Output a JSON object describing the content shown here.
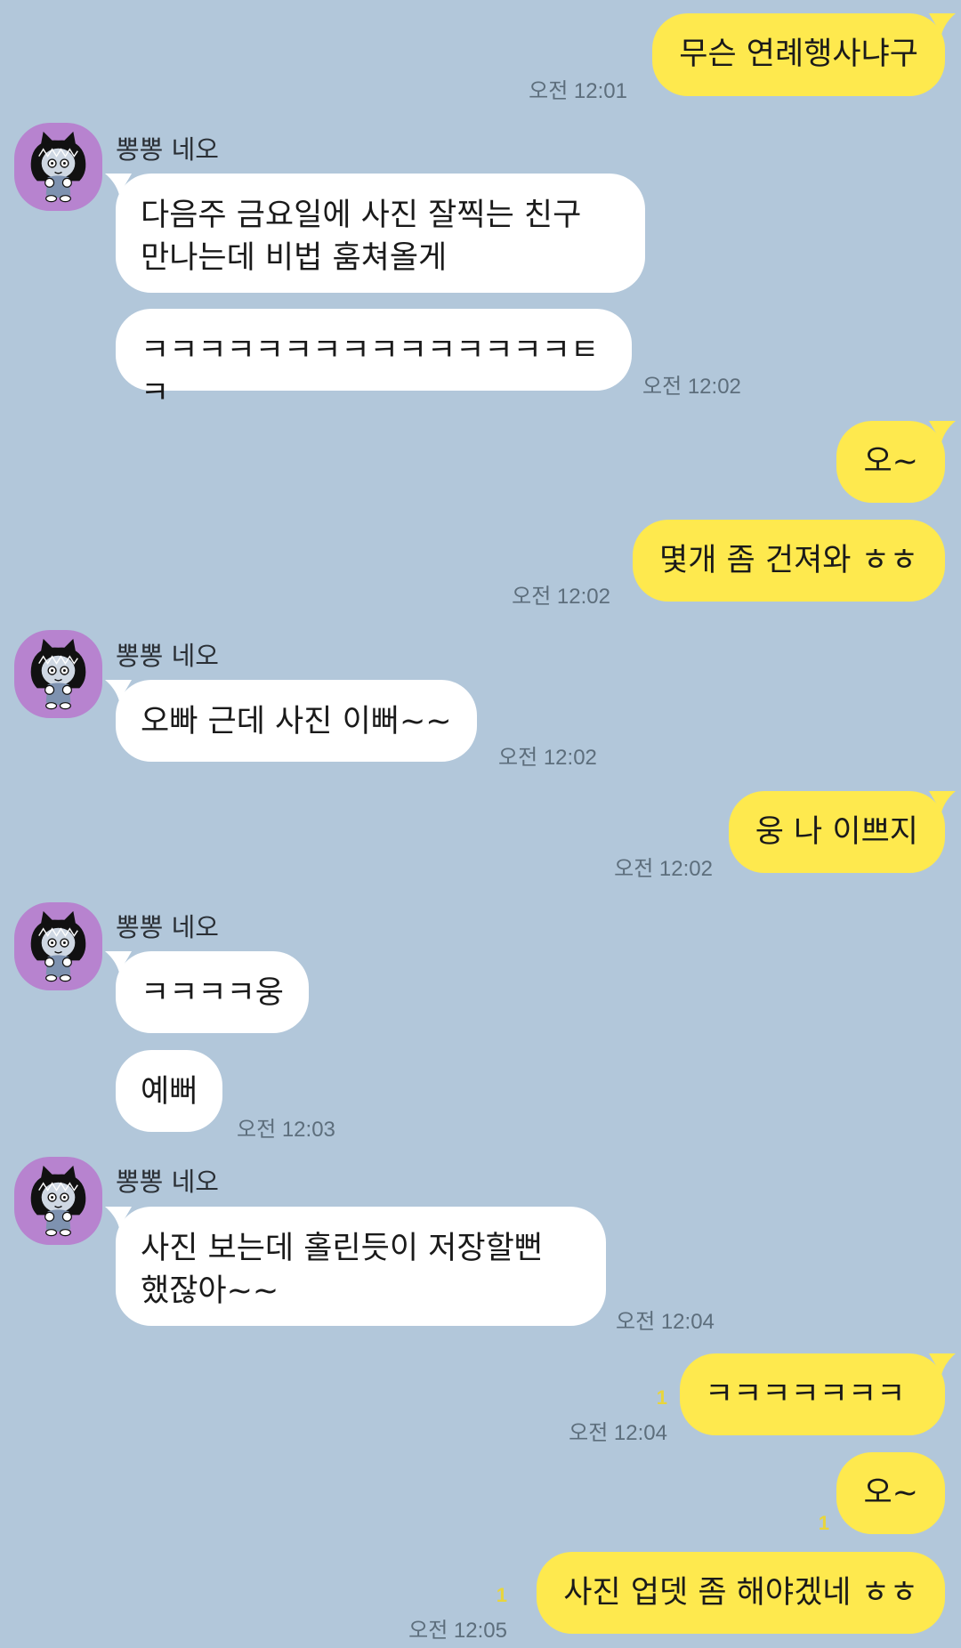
{
  "chat": {
    "sender_name": "뽕뽕 네오",
    "messages": [
      {
        "text": "무슨 연례행사냐구",
        "time": "오전 12:01"
      },
      {
        "text": "다음주 금요일에 사진 잘찍는 친구\n만나는데 비법 훔쳐올게"
      },
      {
        "text": "ㅋㅋㅋㅋㅋㅋㅋㅋㅋㅋㅋㅋㅋㅋㅋㅌㅋ",
        "time": "오전 12:02"
      },
      {
        "text": "오~"
      },
      {
        "text": "몇개 좀 건져와 ㅎㅎ",
        "time": "오전 12:02"
      },
      {
        "text": "오빠 근데 사진 이뻐~~",
        "time": "오전 12:02"
      },
      {
        "text": "웅 나 이쁘지",
        "time": "오전 12:02"
      },
      {
        "text": "ㅋㅋㅋㅋ웅"
      },
      {
        "text": "예뻐",
        "time": "오전 12:03"
      },
      {
        "text": "사진 보는데 홀린듯이 저장할뻔\n했잖아~~",
        "time": "오전 12:04"
      },
      {
        "text": "ㅋㅋㅋㅋㅋㅋㅋ",
        "time": "오전 12:04",
        "unread": "1"
      },
      {
        "text": "오~",
        "unread": "1"
      },
      {
        "text": "사진 업뎃 좀 해야겠네 ㅎㅎ",
        "time": "오전 12:05",
        "unread": "1"
      }
    ]
  },
  "colors": {
    "background": "#b2c7da",
    "outgoing_bubble": "#fee94e",
    "incoming_bubble": "#ffffff",
    "avatar_bg": "#b783cf",
    "unread_count": "#e8d53c"
  },
  "icons": {
    "avatar": "neo-character-icon"
  }
}
